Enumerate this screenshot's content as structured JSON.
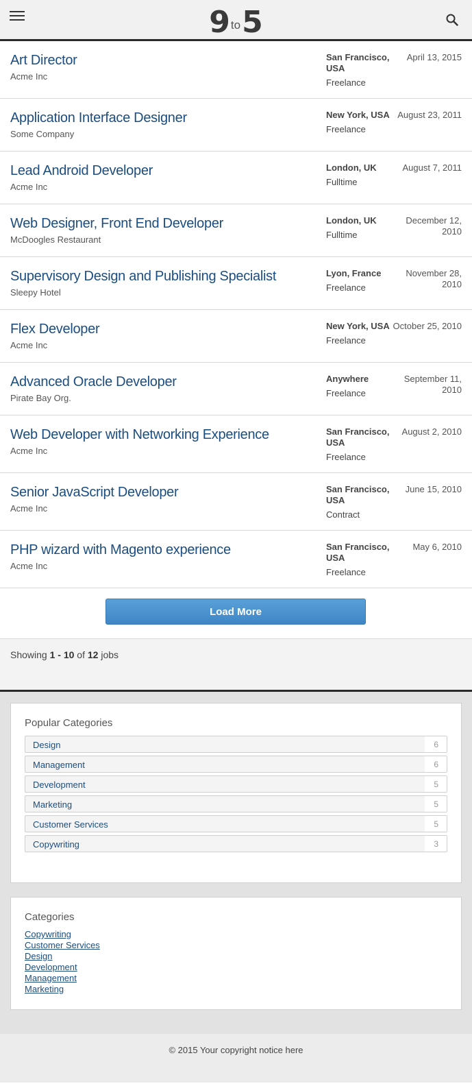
{
  "header": {
    "logo_left": "9",
    "logo_mid": "to",
    "logo_right": "5"
  },
  "jobs": [
    {
      "title": "Art Director",
      "company": "Acme Inc",
      "location": "San Francisco, USA",
      "type": "Freelance",
      "date": "April 13, 2015"
    },
    {
      "title": "Application Interface Designer",
      "company": "Some Company",
      "location": "New York, USA",
      "type": "Freelance",
      "date": "August 23, 2011"
    },
    {
      "title": "Lead Android Developer",
      "company": "Acme Inc",
      "location": "London, UK",
      "type": "Fulltime",
      "date": "August 7, 2011"
    },
    {
      "title": "Web Designer, Front End Developer",
      "company": "McDoogles Restaurant",
      "location": "London, UK",
      "type": "Fulltime",
      "date": "December 12, 2010"
    },
    {
      "title": "Supervisory Design and Publishing Specialist",
      "company": "Sleepy Hotel",
      "location": "Lyon, France",
      "type": "Freelance",
      "date": "November 28, 2010"
    },
    {
      "title": "Flex Developer",
      "company": "Acme Inc",
      "location": "New York, USA",
      "type": "Freelance",
      "date": "October 25, 2010"
    },
    {
      "title": "Advanced Oracle Developer",
      "company": "Pirate Bay Org.",
      "location": "Anywhere",
      "type": "Freelance",
      "date": "September 11, 2010"
    },
    {
      "title": "Web Developer with Networking Experience",
      "company": "Acme Inc",
      "location": "San Francisco, USA",
      "type": "Freelance",
      "date": "August 2, 2010"
    },
    {
      "title": "Senior JavaScript Developer",
      "company": "Acme Inc",
      "location": "San Francisco, USA",
      "type": "Contract",
      "date": "June 15, 2010"
    },
    {
      "title": "PHP wizard with Magento experience",
      "company": "Acme Inc",
      "location": "San Francisco, USA",
      "type": "Freelance",
      "date": "May 6, 2010"
    }
  ],
  "load_more_label": "Load More",
  "showing": {
    "prefix": "Showing",
    "range": "1 - 10",
    "of": "of",
    "total": "12",
    "suffix": "jobs"
  },
  "popular": {
    "title": "Popular Categories",
    "items": [
      {
        "label": "Design",
        "count": "6"
      },
      {
        "label": "Management",
        "count": "6"
      },
      {
        "label": "Development",
        "count": "5"
      },
      {
        "label": "Marketing",
        "count": "5"
      },
      {
        "label": "Customer Services",
        "count": "5"
      },
      {
        "label": "Copywriting",
        "count": "3"
      }
    ]
  },
  "categories": {
    "title": "Categories",
    "items": [
      "Copywriting",
      "Customer Services",
      "Design",
      "Development",
      "Management",
      "Marketing"
    ]
  },
  "footer": {
    "copyright": "© 2015 Your copyright notice here"
  },
  "colors": {
    "link": "#1b4d80",
    "button": "#4a91cf",
    "border_dark": "#2a2a2a"
  }
}
